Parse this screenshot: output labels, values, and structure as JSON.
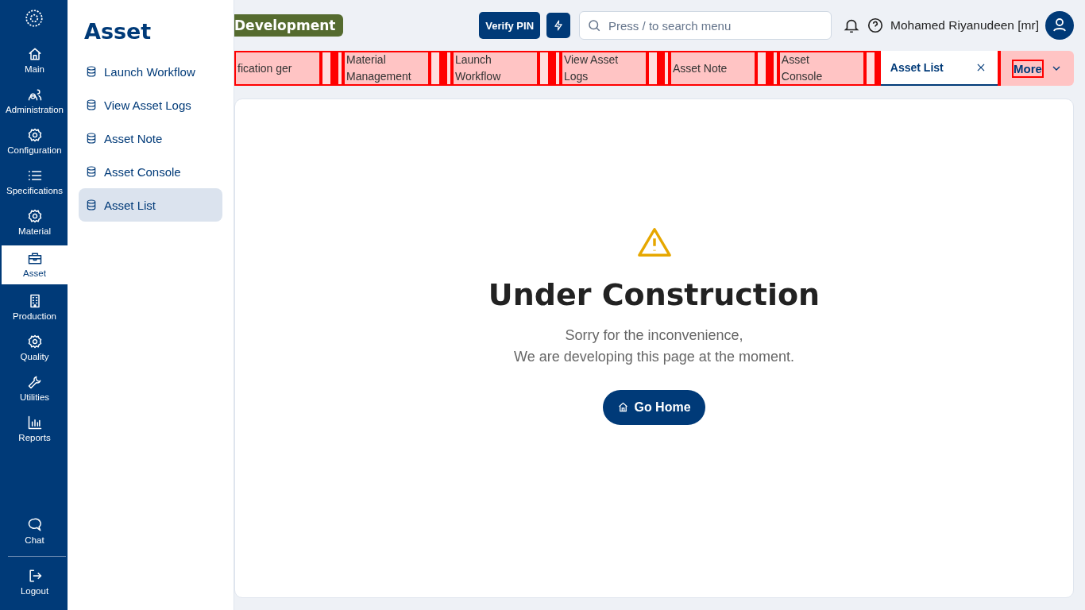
{
  "nav_rail": {
    "items": [
      {
        "label": "Main",
        "selected": false
      },
      {
        "label": "Administration",
        "selected": false
      },
      {
        "label": "Configuration",
        "selected": false
      },
      {
        "label": "Specifications",
        "selected": false
      },
      {
        "label": "Material",
        "selected": false
      },
      {
        "label": "Asset",
        "selected": true
      },
      {
        "label": "Production",
        "selected": false
      },
      {
        "label": "Quality",
        "selected": false
      },
      {
        "label": "Utilities",
        "selected": false
      },
      {
        "label": "Reports",
        "selected": false
      }
    ],
    "footer": [
      {
        "label": "Chat"
      },
      {
        "label": "Logout"
      }
    ]
  },
  "flyout": {
    "title": "Asset",
    "items": [
      {
        "label": "Launch Workflow",
        "selected": false
      },
      {
        "label": "View Asset Logs",
        "selected": false
      },
      {
        "label": "Asset Note",
        "selected": false
      },
      {
        "label": "Asset Console",
        "selected": false
      },
      {
        "label": "Asset List",
        "selected": true
      }
    ]
  },
  "header": {
    "badge": "Development",
    "verify_button": "Verify PIN",
    "search": {
      "placeholder": "Press / to search menu"
    },
    "user_name": "Mohamed Riyanudeen [mr]"
  },
  "tabs": [
    {
      "label": "fication ger",
      "selected": false
    },
    {
      "label": "Material Management",
      "selected": false
    },
    {
      "label": "Launch Workflow",
      "selected": false
    },
    {
      "label": "View Asset Logs",
      "selected": false
    },
    {
      "label": "Asset Note",
      "selected": false
    },
    {
      "label": "Asset Console",
      "selected": false
    },
    {
      "label": "Asset List",
      "selected": true
    }
  ],
  "more_button": "More",
  "notice": {
    "title": "Under Construction",
    "lines": [
      "Sorry for the inconvenience,",
      "We are developing this page at the moment."
    ],
    "button": "Go Home"
  }
}
